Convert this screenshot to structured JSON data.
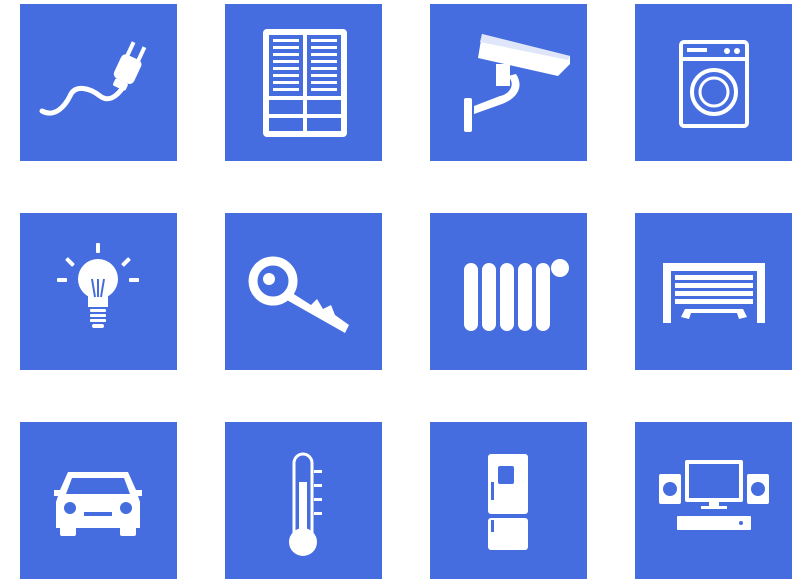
{
  "tile_color": "#466ddf",
  "icon_color": "#ffffff",
  "tiles": [
    {
      "icon": "power-plug-icon"
    },
    {
      "icon": "window-blinds-icon"
    },
    {
      "icon": "security-camera-icon"
    },
    {
      "icon": "washing-machine-icon"
    },
    {
      "icon": "light-bulb-icon"
    },
    {
      "icon": "key-icon"
    },
    {
      "icon": "radiator-icon"
    },
    {
      "icon": "garage-door-icon"
    },
    {
      "icon": "car-icon"
    },
    {
      "icon": "thermometer-icon"
    },
    {
      "icon": "refrigerator-icon"
    },
    {
      "icon": "home-theater-icon"
    }
  ]
}
